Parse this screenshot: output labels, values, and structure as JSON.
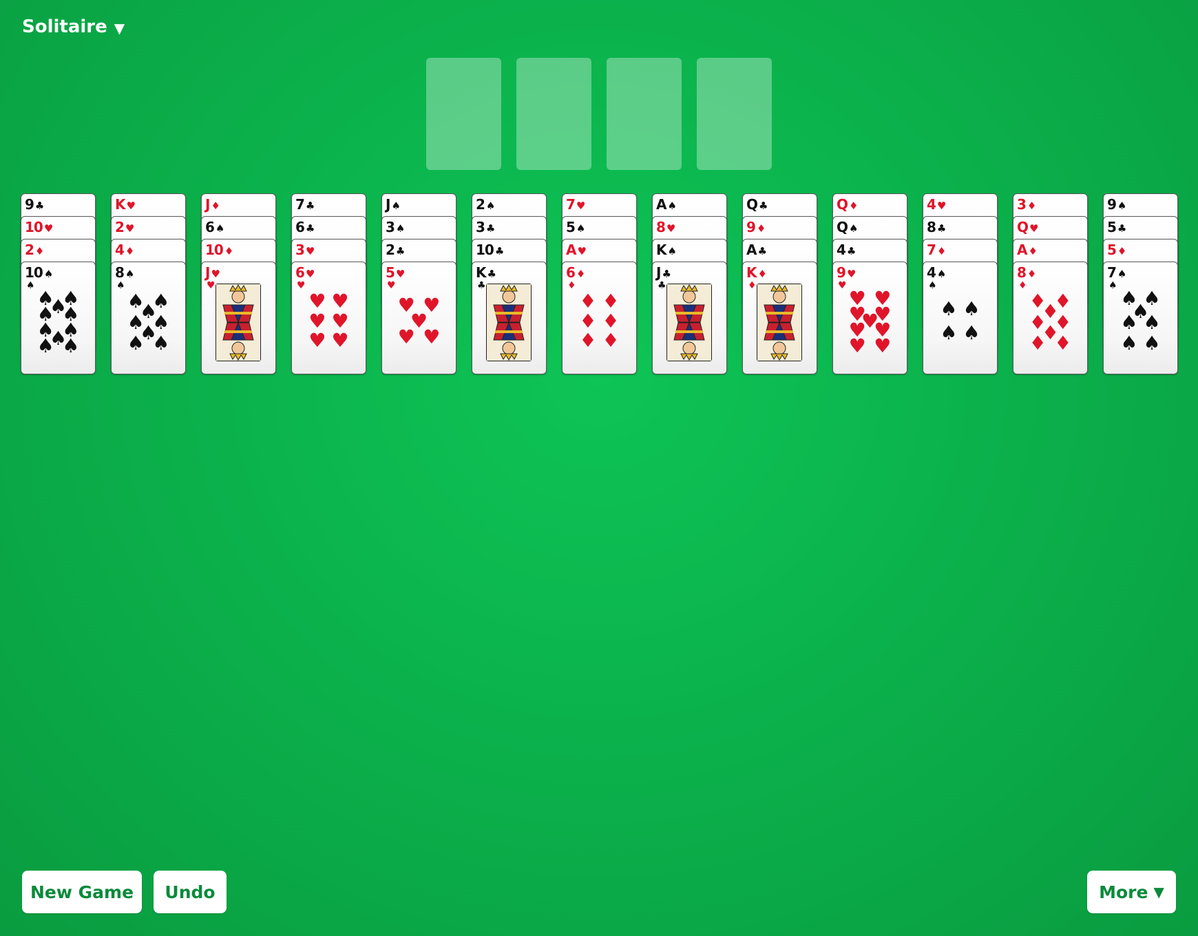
{
  "header": {
    "title": "Solitaire",
    "caret": "▼"
  },
  "foundations": {
    "count": 4
  },
  "tableau": [
    {
      "cards": [
        {
          "rank": "9",
          "suit": "♣"
        },
        {
          "rank": "10",
          "suit": "♥"
        },
        {
          "rank": "2",
          "suit": "♦"
        },
        {
          "rank": "10",
          "suit": "♠"
        }
      ]
    },
    {
      "cards": [
        {
          "rank": "K",
          "suit": "♥"
        },
        {
          "rank": "2",
          "suit": "♥"
        },
        {
          "rank": "4",
          "suit": "♦"
        },
        {
          "rank": "8",
          "suit": "♠"
        }
      ]
    },
    {
      "cards": [
        {
          "rank": "J",
          "suit": "♦"
        },
        {
          "rank": "6",
          "suit": "♠"
        },
        {
          "rank": "10",
          "suit": "♦"
        },
        {
          "rank": "J",
          "suit": "♥"
        }
      ]
    },
    {
      "cards": [
        {
          "rank": "7",
          "suit": "♣"
        },
        {
          "rank": "6",
          "suit": "♣"
        },
        {
          "rank": "3",
          "suit": "♥"
        },
        {
          "rank": "6",
          "suit": "♥"
        }
      ]
    },
    {
      "cards": [
        {
          "rank": "J",
          "suit": "♠"
        },
        {
          "rank": "3",
          "suit": "♠"
        },
        {
          "rank": "2",
          "suit": "♣"
        },
        {
          "rank": "5",
          "suit": "♥"
        }
      ]
    },
    {
      "cards": [
        {
          "rank": "2",
          "suit": "♠"
        },
        {
          "rank": "3",
          "suit": "♣"
        },
        {
          "rank": "10",
          "suit": "♣"
        },
        {
          "rank": "K",
          "suit": "♣"
        }
      ]
    },
    {
      "cards": [
        {
          "rank": "7",
          "suit": "♥"
        },
        {
          "rank": "5",
          "suit": "♠"
        },
        {
          "rank": "A",
          "suit": "♥"
        },
        {
          "rank": "6",
          "suit": "♦"
        }
      ]
    },
    {
      "cards": [
        {
          "rank": "A",
          "suit": "♠"
        },
        {
          "rank": "8",
          "suit": "♥"
        },
        {
          "rank": "K",
          "suit": "♠"
        },
        {
          "rank": "J",
          "suit": "♣"
        }
      ]
    },
    {
      "cards": [
        {
          "rank": "Q",
          "suit": "♣"
        },
        {
          "rank": "9",
          "suit": "♦"
        },
        {
          "rank": "A",
          "suit": "♣"
        },
        {
          "rank": "K",
          "suit": "♦"
        }
      ]
    },
    {
      "cards": [
        {
          "rank": "Q",
          "suit": "♦"
        },
        {
          "rank": "Q",
          "suit": "♠"
        },
        {
          "rank": "4",
          "suit": "♣"
        },
        {
          "rank": "9",
          "suit": "♥"
        }
      ]
    },
    {
      "cards": [
        {
          "rank": "4",
          "suit": "♥"
        },
        {
          "rank": "8",
          "suit": "♣"
        },
        {
          "rank": "7",
          "suit": "♦"
        },
        {
          "rank": "4",
          "suit": "♠"
        }
      ]
    },
    {
      "cards": [
        {
          "rank": "3",
          "suit": "♦"
        },
        {
          "rank": "Q",
          "suit": "♥"
        },
        {
          "rank": "A",
          "suit": "♦"
        },
        {
          "rank": "8",
          "suit": "♦"
        }
      ]
    },
    {
      "cards": [
        {
          "rank": "9",
          "suit": "♠"
        },
        {
          "rank": "5",
          "suit": "♣"
        },
        {
          "rank": "5",
          "suit": "♦"
        },
        {
          "rank": "7",
          "suit": "♠"
        }
      ]
    }
  ],
  "buttons": {
    "new_game": "New Game",
    "undo": "Undo",
    "more": "More",
    "more_caret": "▼"
  },
  "colors": {
    "felt": "#0bb24c",
    "red_suit": "#e0152a",
    "black_suit": "#111111",
    "button_text": "#0a8a3a"
  }
}
